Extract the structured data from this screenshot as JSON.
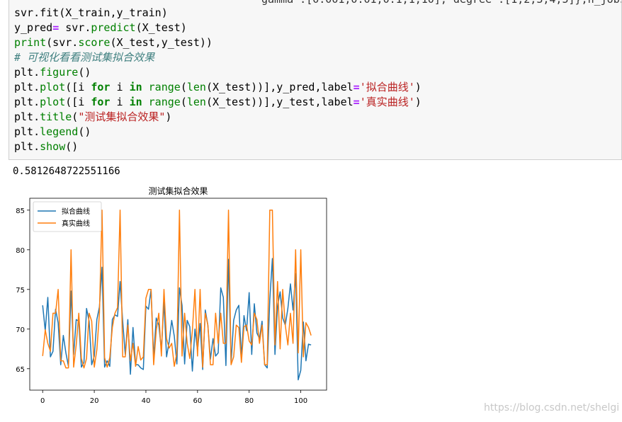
{
  "code_cell": {
    "partial_top_line": "gamma':[0.001,0.01,0.1,1,10], degree':[1,2,3,4,5]},n_jobs",
    "lines": [
      [
        {
          "t": "svr",
          "c": "var"
        },
        {
          "t": ".",
          "c": "var"
        },
        {
          "t": "fit",
          "c": "var"
        },
        {
          "t": "(X_train,y_train)",
          "c": "var"
        }
      ],
      [
        {
          "t": "y_pred",
          "c": "var"
        },
        {
          "t": "=",
          "c": "op"
        },
        {
          "t": " svr.",
          "c": "var"
        },
        {
          "t": "predict",
          "c": "fn"
        },
        {
          "t": "(X_test)",
          "c": "var"
        }
      ],
      [
        {
          "t": "print",
          "c": "fn"
        },
        {
          "t": "(svr.",
          "c": "var"
        },
        {
          "t": "score",
          "c": "fn"
        },
        {
          "t": "(X_test,y_test))",
          "c": "var"
        }
      ],
      [
        {
          "t": "# 可视化看看测试集拟合效果",
          "c": "cm"
        }
      ],
      [
        {
          "t": "plt.",
          "c": "var"
        },
        {
          "t": "figure",
          "c": "fn"
        },
        {
          "t": "()",
          "c": "var"
        }
      ],
      [
        {
          "t": "plt.",
          "c": "var"
        },
        {
          "t": "plot",
          "c": "fn"
        },
        {
          "t": "([i ",
          "c": "var"
        },
        {
          "t": "for",
          "c": "kw"
        },
        {
          "t": " i ",
          "c": "var"
        },
        {
          "t": "in",
          "c": "kw"
        },
        {
          "t": " ",
          "c": "var"
        },
        {
          "t": "range",
          "c": "fn"
        },
        {
          "t": "(",
          "c": "var"
        },
        {
          "t": "len",
          "c": "fn"
        },
        {
          "t": "(X_test))],y_pred,label",
          "c": "var"
        },
        {
          "t": "=",
          "c": "op"
        },
        {
          "t": "'拟合曲线'",
          "c": "str"
        },
        {
          "t": ")",
          "c": "var"
        }
      ],
      [
        {
          "t": "plt.",
          "c": "var"
        },
        {
          "t": "plot",
          "c": "fn"
        },
        {
          "t": "([i ",
          "c": "var"
        },
        {
          "t": "for",
          "c": "kw"
        },
        {
          "t": " i ",
          "c": "var"
        },
        {
          "t": "in",
          "c": "kw"
        },
        {
          "t": " ",
          "c": "var"
        },
        {
          "t": "range",
          "c": "fn"
        },
        {
          "t": "(",
          "c": "var"
        },
        {
          "t": "len",
          "c": "fn"
        },
        {
          "t": "(X_test))],y_test,label",
          "c": "var"
        },
        {
          "t": "=",
          "c": "op"
        },
        {
          "t": "'真实曲线'",
          "c": "str"
        },
        {
          "t": ")",
          "c": "var"
        }
      ],
      [
        {
          "t": "plt.",
          "c": "var"
        },
        {
          "t": "title",
          "c": "fn"
        },
        {
          "t": "(",
          "c": "var"
        },
        {
          "t": "\"测试集拟合效果\"",
          "c": "str"
        },
        {
          "t": ")",
          "c": "var"
        }
      ],
      [
        {
          "t": "plt.",
          "c": "var"
        },
        {
          "t": "legend",
          "c": "fn"
        },
        {
          "t": "()",
          "c": "var"
        }
      ],
      [
        {
          "t": "plt.",
          "c": "var"
        },
        {
          "t": "show",
          "c": "fn"
        },
        {
          "t": "()",
          "c": "var"
        }
      ]
    ]
  },
  "output": {
    "score_text": "0.5812648722551166"
  },
  "watermark": "https://blog.csdn.net/shelgi",
  "colors": {
    "series_blue": "#1f77b4",
    "series_orange": "#ff7f0e"
  },
  "chart_data": {
    "type": "line",
    "title": "测试集拟合效果",
    "xlabel": "",
    "ylabel": "",
    "xlim": [
      -5,
      110
    ],
    "ylim": [
      62.3,
      86.5
    ],
    "xticks": [
      0,
      20,
      40,
      60,
      80,
      100
    ],
    "yticks": [
      65,
      70,
      75,
      80,
      85
    ],
    "legend_placement": "top-left",
    "grid": false,
    "series": [
      {
        "name": "拟合曲线",
        "color": "#1f77b4",
        "x": [
          0,
          1,
          2,
          3,
          4,
          5,
          6,
          7,
          8,
          9,
          10,
          11,
          12,
          13,
          14,
          15,
          16,
          17,
          18,
          19,
          20,
          21,
          22,
          23,
          24,
          25,
          26,
          27,
          28,
          29,
          30,
          31,
          32,
          33,
          34,
          35,
          36,
          37,
          38,
          39,
          40,
          41,
          42,
          43,
          44,
          45,
          46,
          47,
          48,
          49,
          50,
          51,
          52,
          53,
          54,
          55,
          56,
          57,
          58,
          59,
          60,
          61,
          62,
          63,
          64,
          65,
          66,
          67,
          68,
          69,
          70,
          71,
          72,
          73,
          74,
          75,
          76,
          77,
          78,
          79,
          80,
          81,
          82,
          83,
          84,
          85,
          86,
          87,
          88,
          89,
          90,
          91,
          92,
          93,
          94,
          95,
          96,
          97,
          98,
          99,
          100,
          101,
          102,
          103,
          104
        ],
        "values": [
          73,
          69.8,
          74,
          66.5,
          67.2,
          72.5,
          70.8,
          65.5,
          69.2,
          67,
          65.3,
          74.8,
          66.8,
          71.2,
          71,
          65.2,
          65.8,
          72.6,
          71,
          65.5,
          66.6,
          71.2,
          72.8,
          77.8,
          65.2,
          66,
          65.3,
          71.2,
          71.8,
          71.6,
          76,
          71,
          66.8,
          71.2,
          64.3,
          70.2,
          65.5,
          65.5,
          65.1,
          64.9,
          72.9,
          72.5,
          75,
          66.3,
          71.4,
          70.5,
          67.4,
          73.4,
          66.5,
          68.4,
          71.1,
          69.1,
          65.6,
          75.2,
          73,
          65.6,
          71.1,
          70.3,
          64.7,
          70,
          67.3,
          70.7,
          64.9,
          72.4,
          70.5,
          66.2,
          68.8,
          66.6,
          67,
          75.2,
          74,
          65.4,
          78.8,
          65.7,
          71.1,
          72.4,
          73,
          66.4,
          71.7,
          69.8,
          74.6,
          66.8,
          73.2,
          69.5,
          68.8,
          71,
          65.5,
          65.1,
          73.7,
          78.9,
          66.8,
          72.9,
          74.7,
          71.4,
          70.5,
          72.6,
          75.7,
          72.4,
          77,
          63.6,
          64.8,
          70.9,
          66,
          68.1,
          68
        ]
      },
      {
        "name": "真实曲线",
        "color": "#ff7f0e",
        "x": [
          0,
          1,
          2,
          3,
          4,
          5,
          6,
          7,
          8,
          9,
          10,
          11,
          12,
          13,
          14,
          15,
          16,
          17,
          18,
          19,
          20,
          21,
          22,
          23,
          24,
          25,
          26,
          27,
          28,
          29,
          30,
          31,
          32,
          33,
          34,
          35,
          36,
          37,
          38,
          39,
          40,
          41,
          42,
          43,
          44,
          45,
          46,
          47,
          48,
          49,
          50,
          51,
          52,
          53,
          54,
          55,
          56,
          57,
          58,
          59,
          60,
          61,
          62,
          63,
          64,
          65,
          66,
          67,
          68,
          69,
          70,
          71,
          72,
          73,
          74,
          75,
          76,
          77,
          78,
          79,
          80,
          81,
          82,
          83,
          84,
          85,
          86,
          87,
          88,
          89,
          90,
          91,
          92,
          93,
          94,
          95,
          96,
          97,
          98,
          99,
          100,
          101,
          102,
          103,
          104
        ],
        "values": [
          66.6,
          69.9,
          68.2,
          67.2,
          72,
          72,
          75,
          66,
          66,
          65.1,
          65.1,
          80,
          65.2,
          68,
          72,
          66.3,
          65.1,
          66.3,
          72,
          71,
          65.2,
          67.4,
          72,
          85,
          66.4,
          65.2,
          66.4,
          70.2,
          72,
          72.7,
          85,
          66.5,
          66.5,
          70.5,
          66,
          68.2,
          65.3,
          67.8,
          66.1,
          66.5,
          73.9,
          75,
          75,
          65.5,
          69.8,
          72,
          66.6,
          75,
          68.8,
          67.6,
          68.2,
          65.3,
          67,
          85,
          66.6,
          72,
          68.2,
          66.3,
          69.8,
          75,
          66.6,
          75,
          65.2,
          72,
          70.5,
          65.5,
          65.5,
          72,
          68.2,
          72,
          68.2,
          68.2,
          85,
          65.5,
          66.5,
          70.5,
          70.2,
          65.8,
          70.3,
          70.5,
          68.5,
          68,
          72,
          71.2,
          68.2,
          70.5,
          65.5,
          65.5,
          85,
          85,
          68,
          76,
          67.5,
          75,
          70.5,
          68,
          72,
          68.2,
          80,
          67,
          80,
          66.5,
          70.8,
          70.2,
          69.2
        ]
      }
    ]
  }
}
